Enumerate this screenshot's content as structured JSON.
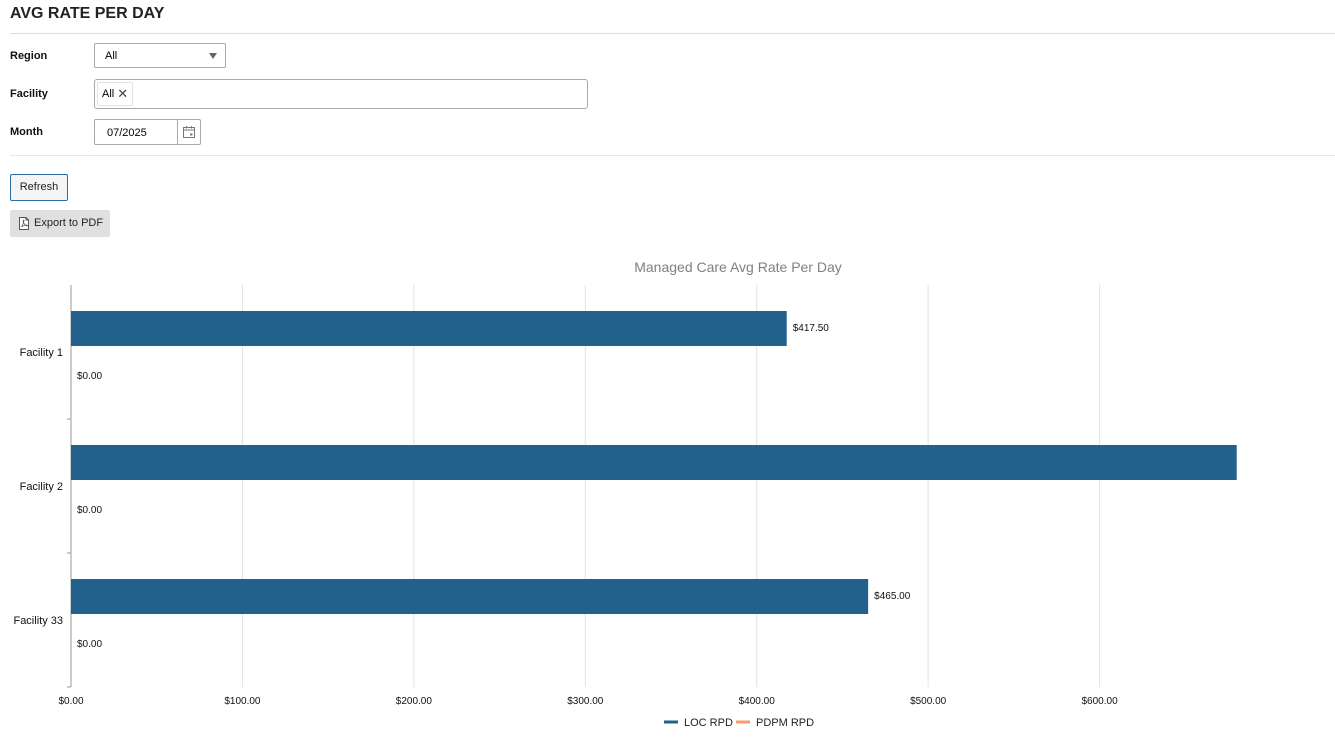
{
  "page": {
    "title": "AVG RATE PER DAY"
  },
  "filters": {
    "region_label": "Region",
    "region_value": "All",
    "facility_label": "Facility",
    "facility_chip": "All",
    "month_label": "Month",
    "month_value": "07/2025"
  },
  "buttons": {
    "refresh_label": "Refresh",
    "export_label": "Export to PDF"
  },
  "icons": {
    "region_dropdown": "chevron-down-icon",
    "facility_chip_remove": "close-icon",
    "month_picker": "calendar-icon",
    "export": "pdf-file-icon"
  },
  "chart_data": {
    "type": "bar",
    "orientation": "horizontal",
    "title": "Managed Care Avg Rate Per Day",
    "categories": [
      "Facility 1",
      "Facility 2",
      "Facility 33"
    ],
    "series": [
      {
        "name": "LOC RPD",
        "color": "#22618c",
        "values": [
          417.5,
          680.0,
          465.0
        ],
        "labels": [
          "$417.50",
          "",
          "$465.00"
        ]
      },
      {
        "name": "PDPM RPD",
        "color": "#f79d6b",
        "values": [
          0,
          0,
          0
        ],
        "labels": [
          "$0.00",
          "$0.00",
          "$0.00"
        ]
      }
    ],
    "xticks": [
      "$0.00",
      "$100.00",
      "$200.00",
      "$300.00",
      "$400.00",
      "$500.00",
      "$600.00"
    ],
    "xlim": [
      0,
      700
    ],
    "grid": true,
    "legend": "bottom"
  }
}
